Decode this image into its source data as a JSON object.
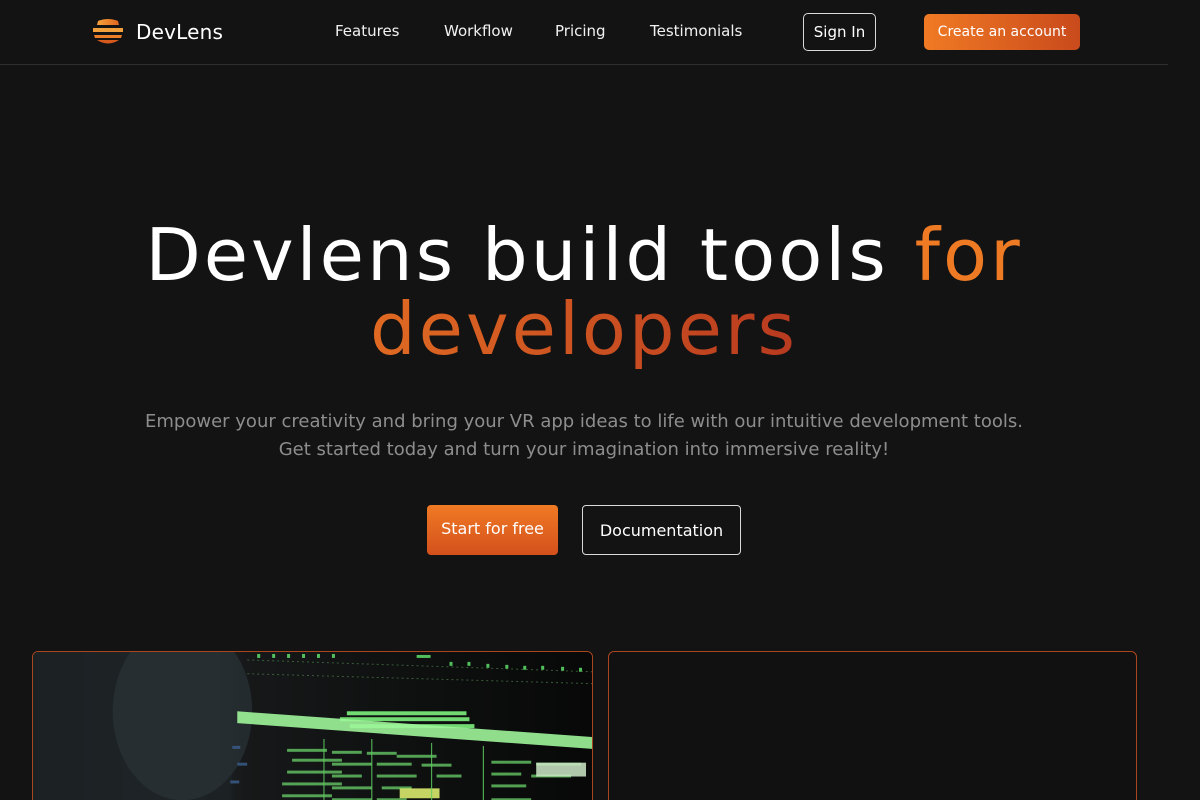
{
  "brand": {
    "name": "DevLens",
    "logo_icon": "layered-disc-logo"
  },
  "nav": {
    "links": [
      "Features",
      "Workflow",
      "Pricing",
      "Testimonials"
    ],
    "sign_in": "Sign In",
    "create_account": "Create an account"
  },
  "hero": {
    "title_main": "Devlens build tools",
    "title_accent_1": "for",
    "title_accent_2": "developers",
    "subtitle_line1": "Empower your creativity and bring your VR app ideas to life with our intuitive development tools.",
    "subtitle_line2": "Get started today and turn your imagination into immersive reality!",
    "primary_cta": "Start for free",
    "secondary_cta": "Documentation"
  },
  "colors": {
    "background": "#131313",
    "accent": "#ef7a24",
    "accent_dark": "#b83a20",
    "card_border": "#a8471f",
    "muted_text": "#8d8d8d"
  }
}
